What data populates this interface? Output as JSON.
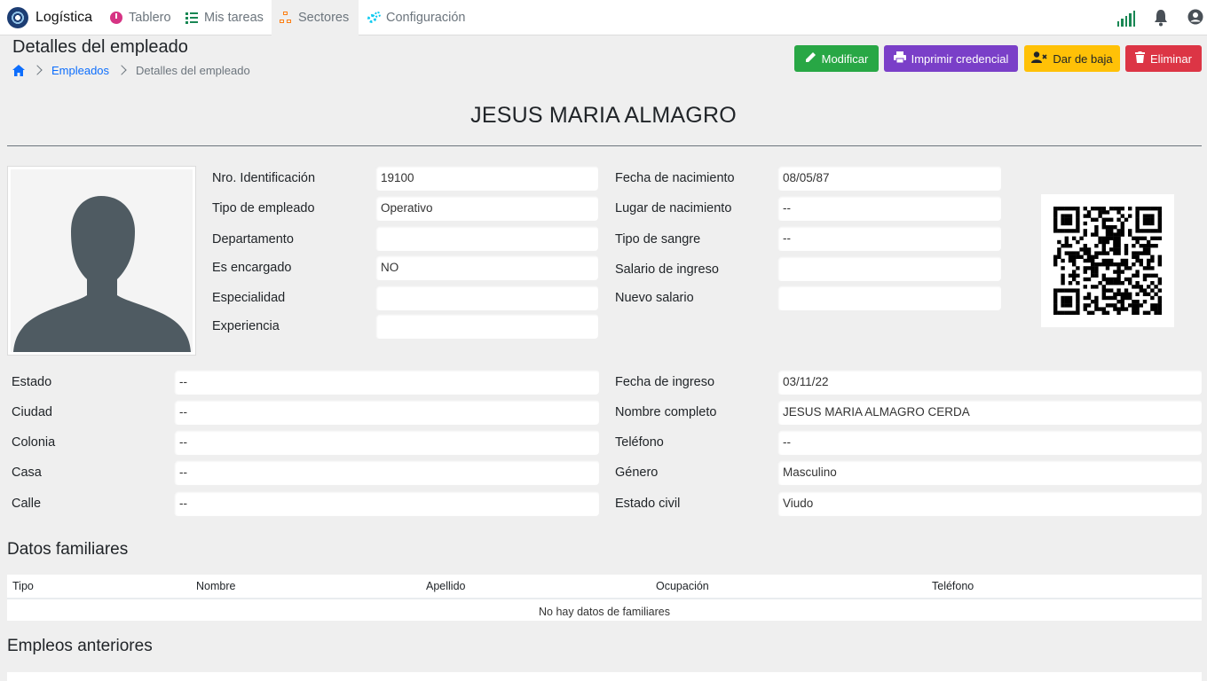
{
  "app": {
    "name": "Logística"
  },
  "nav": {
    "tablero": "Tablero",
    "tareas": "Mis tareas",
    "sectores": "Sectores",
    "configuracion": "Configuración"
  },
  "header": {
    "title": "Detalles del empleado",
    "breadcrumb": {
      "link": "Empleados",
      "current": "Detalles del empleado"
    }
  },
  "actions": {
    "modificar": "Modificar",
    "imprimir": "Imprimir credencial",
    "baja": "Dar de baja",
    "eliminar": "Eliminar"
  },
  "employee": {
    "name": "JESUS MARIA ALMAGRO",
    "left_fields": [
      {
        "label": "Nro. Identificación",
        "value": "19100"
      },
      {
        "label": "Tipo de empleado",
        "value": "Operativo"
      },
      {
        "label": "Departamento",
        "value": ""
      },
      {
        "label": "Es encargado",
        "value": "NO"
      },
      {
        "label": "Especialidad",
        "value": ""
      },
      {
        "label": "Experiencia",
        "value": ""
      }
    ],
    "mid_fields": [
      {
        "label": "Fecha de nacimiento",
        "value": "08/05/87"
      },
      {
        "label": "Lugar de nacimiento",
        "value": "--"
      },
      {
        "label": "Tipo de sangre",
        "value": "--"
      },
      {
        "label": "Salario de ingreso",
        "value": ""
      },
      {
        "label": "Nuevo salario",
        "value": ""
      }
    ],
    "address_fields": [
      {
        "label": "Estado",
        "value": "--"
      },
      {
        "label": "Ciudad",
        "value": "--"
      },
      {
        "label": "Colonia",
        "value": "--"
      },
      {
        "label": "Casa",
        "value": "--"
      },
      {
        "label": "Calle",
        "value": "--"
      }
    ],
    "personal_fields": [
      {
        "label": "Fecha de ingreso",
        "value": "03/11/22"
      },
      {
        "label": "Nombre completo",
        "value": "JESUS MARIA ALMAGRO CERDA"
      },
      {
        "label": "Teléfono",
        "value": "--"
      },
      {
        "label": "Género",
        "value": "Masculino"
      },
      {
        "label": "Estado civil",
        "value": "Viudo"
      }
    ]
  },
  "familiares": {
    "title": "Datos familiares",
    "columns": [
      "Tipo",
      "Nombre",
      "Apellido",
      "Ocupación",
      "Teléfono"
    ],
    "empty": "No hay datos de familiares"
  },
  "empleos": {
    "title": "Empleos anteriores"
  },
  "colors": {
    "accent_green": "#28a745",
    "accent_purple": "#7a3fc8",
    "accent_yellow": "#ffc107",
    "accent_red": "#dc3545",
    "link": "#0d6efd",
    "avatar": "#4f5b62"
  }
}
